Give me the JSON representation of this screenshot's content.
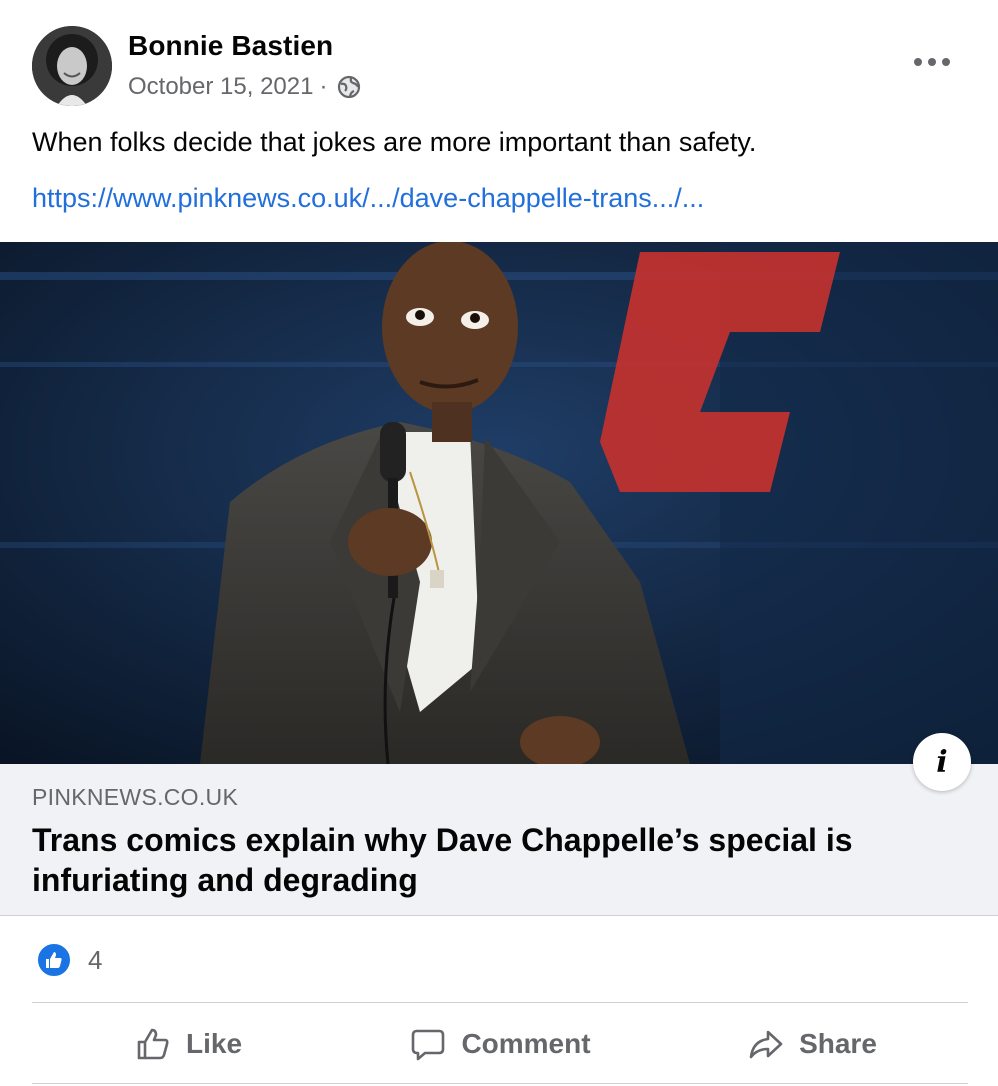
{
  "post": {
    "author": "Bonnie Bastien",
    "date": "October 15, 2021",
    "separator": "·",
    "privacy_icon": "globe-icon",
    "more_icon": "ellipsis-icon",
    "text": "When folks decide that jokes are more important than safety.",
    "link_text": "https://www.pinknews.co.uk/.../dave-chappelle-trans.../..."
  },
  "link_card": {
    "domain": "PINKNEWS.CO.UK",
    "headline": "Trans comics explain why Dave Chappelle’s special is infuriating and degrading",
    "info_label": "i"
  },
  "reactions": {
    "icon": "thumbs-up-icon",
    "count": "4"
  },
  "actions": {
    "like": "Like",
    "comment": "Comment",
    "share": "Share"
  },
  "colors": {
    "link": "#216fdb",
    "secondary_text": "#65676b",
    "like_blue": "#1b74e4",
    "card_bg": "#f0f2f5"
  }
}
